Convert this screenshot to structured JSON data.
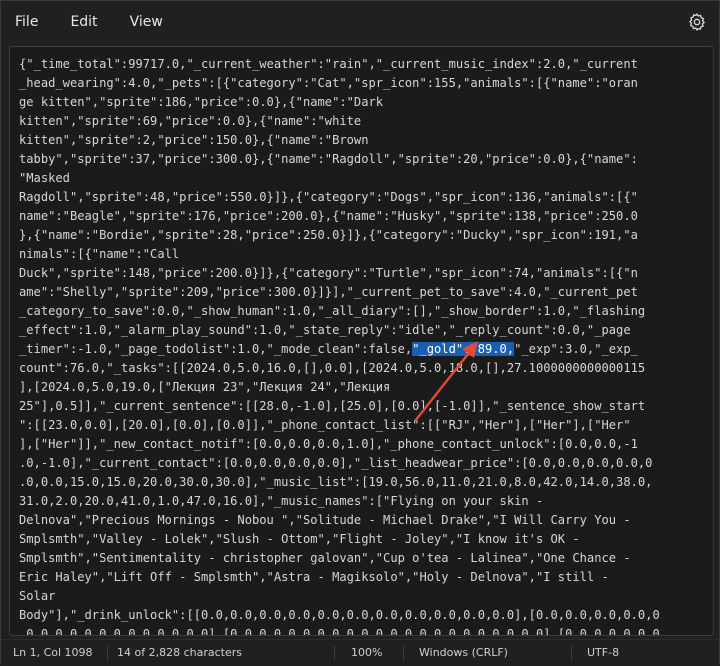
{
  "menu": {
    "file": "File",
    "edit": "Edit",
    "view": "View"
  },
  "icons": {
    "settings": "gear-icon"
  },
  "editor": {
    "lines": [
      "{\"_time_total\":99717.0,\"_current_weather\":\"rain\",\"_current_music_index\":2.0,\"_current",
      "_head_wearing\":4.0,\"_pets\":[{\"category\":\"Cat\",\"spr_icon\":155,\"animals\":[{\"name\":\"oran",
      "ge kitten\",\"sprite\":186,\"price\":0.0},{\"name\":\"Dark",
      "kitten\",\"sprite\":69,\"price\":0.0},{\"name\":\"white",
      "kitten\",\"sprite\":2,\"price\":150.0},{\"name\":\"Brown",
      "tabby\",\"sprite\":37,\"price\":300.0},{\"name\":\"Ragdoll\",\"sprite\":20,\"price\":0.0},{\"name\":",
      "\"Masked",
      "Ragdoll\",\"sprite\":48,\"price\":550.0}]},{\"category\":\"Dogs\",\"spr_icon\":136,\"animals\":[{\"",
      "name\":\"Beagle\",\"sprite\":176,\"price\":200.0},{\"name\":\"Husky\",\"sprite\":138,\"price\":250.0",
      "},{\"name\":\"Bordie\",\"sprite\":28,\"price\":250.0}]},{\"category\":\"Ducky\",\"spr_icon\":191,\"a",
      "nimals\":[{\"name\":\"Call",
      "Duck\",\"sprite\":148,\"price\":200.0}]},{\"category\":\"Turtle\",\"spr_icon\":74,\"animals\":[{\"n",
      "ame\":\"Shelly\",\"sprite\":209,\"price\":300.0}]}],\"_current_pet_to_save\":4.0,\"_current_pet",
      "_category_to_save\":0.0,\"_show_human\":1.0,\"_all_diary\":[],\"_show_border\":1.0,\"_flashing",
      "_effect\":1.0,\"_alarm_play_sound\":1.0,\"_state_reply\":\"idle\",\"_reply_count\":0.0,\"_page",
      "_timer\":-1.0,\"_page_todolist\":1.0,\"_mode_clean\":false,",
      "count\":76.0,\"_tasks\":[[2024.0,5.0,16.0,[],0.0],[2024.0,5.0,18.0,[],27.1000000000000115",
      "],[2024.0,5.0,19.0,[\"Лекция 23\",\"Лекция 24\",\"Лекция",
      "25\"],0.5]],\"_current_sentence\":[[28.0,-1.0],[25.0],[0.0],[-1.0]],\"_sentence_show_start",
      "\":[[23.0,0.0],[20.0],[0.0],[0.0]],\"_phone_contact_list\":[[\"RJ\",\"Her\"],[\"Her\"],[\"Her\"",
      "],[\"Her\"]],\"_new_contact_notif\":[0.0,0.0,0.0,1.0],\"_phone_contact_unlock\":[0.0,0.0,-1",
      ".0,-1.0],\"_current_contact\":[0.0,0.0,0.0,0.0],\"_list_headwear_price\":[0.0,0.0,0.0,0.0,0",
      ".0,0.0,15.0,15.0,20.0,30.0,30.0],\"_music_list\":[19.0,56.0,11.0,21.0,8.0,42.0,14.0,38.0,",
      "31.0,2.0,20.0,41.0,1.0,47.0,16.0],\"_music_names\":[\"Flying on your skin -",
      "Delnova\",\"Precious Mornings - Nobou \",\"Solitude - Michael Drake\",\"I Will Carry You -",
      "Smplsmth\",\"Valley - Lolek\",\"Slush - Ottom\",\"Flight - Joley\",\"I know it's OK -",
      "Smplsmth\",\"Sentimentality - christopher galovan\",\"Cup o'tea - Lalinea\",\"One Chance -",
      "Eric Haley\",\"Lift Off - Smplsmth\",\"Astra - Magiksolo\",\"Holy - Delnova\",\"I still -",
      "Solar",
      "Body\"],\"_drink_unlock\":[[0.0,0.0,0.0,0.0,0.0,0.0,0.0,0.0,0.0,0.0,0.0],[0.0,0.0,0.0,0.0,0",
      ".0,0.0,0.0,0.0,0.0,0.0,0.0],[0.0,0.0,0.0,0.0,0.0,0.0,0.0,0.0,0.0,0.0,0.0],[0.0,0.0,0.0,0",
      ".0,0.0,0.0,0.0,0.0,0.0,0.0,0.0]],\"_current_language\":5.0,\"_current_music\":11.0,\"_fish\":[[\"obj_c"
    ],
    "highlight": "\"_gold\":789.0,",
    "after_highlight": "\"_exp\":3.0,\"_exp_"
  },
  "status": {
    "position": "Ln 1, Col 1098",
    "chars": "14 of 2,828 characters",
    "zoom": "100%",
    "line_ending": "Windows (CRLF)",
    "encoding": "UTF-8"
  },
  "colors": {
    "highlight": "#1a5fb4",
    "arrow": "#e04a3a"
  }
}
